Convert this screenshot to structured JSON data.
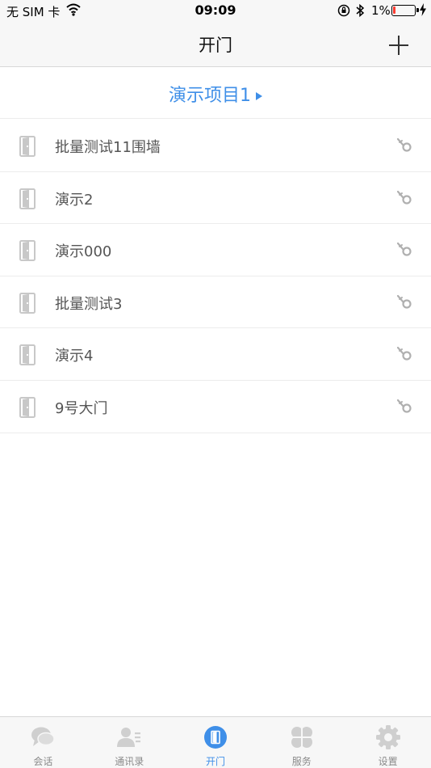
{
  "status_bar": {
    "carrier": "无 SIM 卡",
    "time": "09:09",
    "battery_percent": "1%"
  },
  "nav": {
    "title": "开门",
    "add_icon": "plus-icon"
  },
  "project": {
    "name": "演示项目1"
  },
  "doors": [
    {
      "name": "批量测试11围墙"
    },
    {
      "name": "演示2"
    },
    {
      "name": "演示000"
    },
    {
      "name": "批量测试3"
    },
    {
      "name": "演示4"
    },
    {
      "name": "9号大门"
    }
  ],
  "tabs": [
    {
      "label": "会话",
      "icon": "chat-icon"
    },
    {
      "label": "通讯录",
      "icon": "contacts-icon"
    },
    {
      "label": "开门",
      "icon": "door-icon"
    },
    {
      "label": "服务",
      "icon": "services-icon"
    },
    {
      "label": "设置",
      "icon": "settings-icon"
    }
  ],
  "colors": {
    "accent": "#3f8fe8",
    "icon_gray": "#cccccc",
    "bar_background": "#f7f7f7"
  }
}
